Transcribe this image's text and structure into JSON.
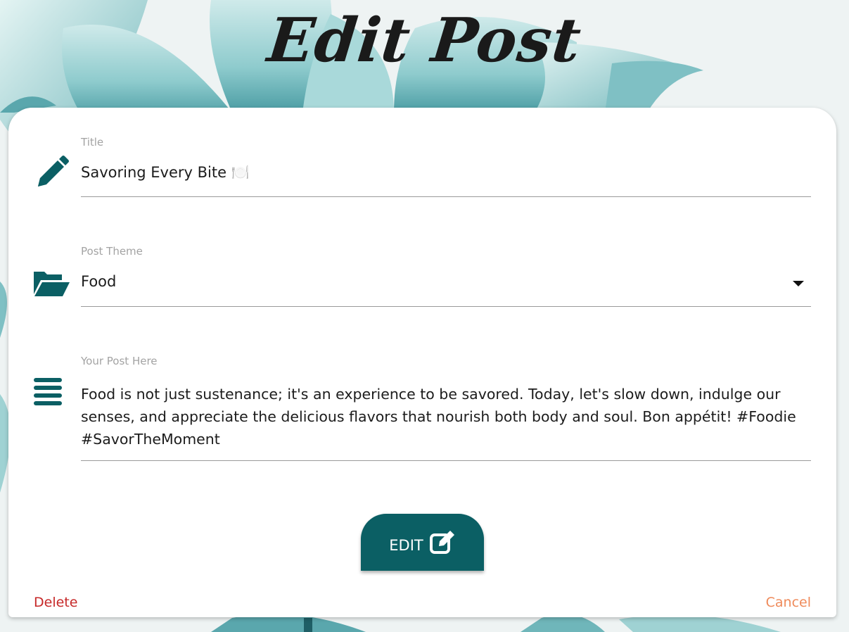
{
  "page": {
    "title": "Edit Post"
  },
  "form": {
    "title_field": {
      "label": "Title",
      "value": "Savoring Every Bite 🍽️"
    },
    "theme_field": {
      "label": "Post Theme",
      "value": "Food"
    },
    "post_field": {
      "label": "Your Post Here",
      "value": "Food is not just sustenance; it's an experience to be savored. Today, let's slow down, indulge our senses, and appreciate the delicious flavors that nourish both body and soul. Bon appétit! #Foodie #SavorTheMoment"
    }
  },
  "actions": {
    "edit_label": "EDIT",
    "delete_label": "Delete",
    "cancel_label": "Cancel"
  },
  "icons": {
    "title": "pencil-icon",
    "theme": "folder-open-icon",
    "post": "align-justify-icon",
    "edit": "edit-square-icon"
  },
  "colors": {
    "accent": "#0b5f64",
    "delete": "#c62828",
    "cancel": "#ef8a5a",
    "background_petals": "#8fc9cc"
  }
}
